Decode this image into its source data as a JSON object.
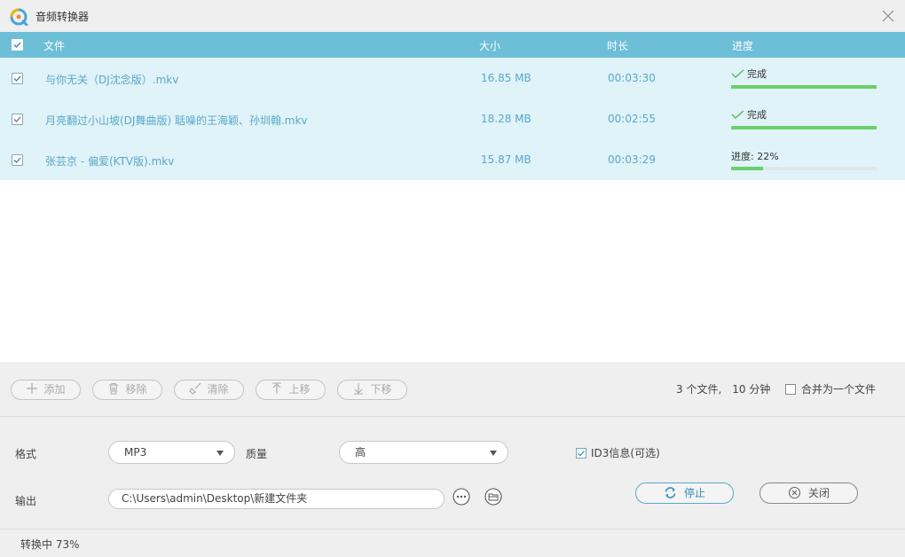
{
  "window": {
    "title": "音频转换器",
    "icons": {
      "logo": "app-logo-icon",
      "close": "close-icon"
    }
  },
  "colors": {
    "header_bg": "#6dbed7",
    "row_bg": "#dff3f8",
    "row_text": "#5aa8c9",
    "progress_fill": "#6ccf6a",
    "stop_accent": "#57a9cf"
  },
  "list": {
    "columns": {
      "file": "文件",
      "size": "大小",
      "duration": "时长",
      "progress": "进度"
    },
    "rows": [
      {
        "checked": true,
        "file": "与你无关（DJ沈念版）.mkv",
        "size": "16.85 MB",
        "duration": "00:03:30",
        "status": "完成",
        "done": true,
        "progress": 1.0
      },
      {
        "checked": true,
        "file": "月亮翻过小山坡(DJ舞曲版) 聒噪的王海颖、孙圳翰.mkv",
        "size": "18.28 MB",
        "duration": "00:02:55",
        "status": "完成",
        "done": true,
        "progress": 1.0
      },
      {
        "checked": true,
        "file": "张芸京 - 偏爱(KTV版).mkv",
        "size": "15.87 MB",
        "duration": "00:03:29",
        "status": "进度: 22%",
        "done": false,
        "progress": 0.22
      }
    ]
  },
  "toolbar": {
    "add": "添加",
    "remove": "移除",
    "clear": "清除",
    "up": "上移",
    "down": "下移",
    "icons": {
      "add": "plus-icon",
      "remove": "trash-icon",
      "clear": "broom-icon",
      "up": "arrow-up-icon",
      "down": "arrow-down-icon"
    },
    "summary": "3 个文件,　10 分钟",
    "merge_label": "合并为一个文件",
    "merge_checked": false
  },
  "settings": {
    "format_label": "格式",
    "format_value": "MP3",
    "quality_label": "质量",
    "quality_value": "高",
    "id3_label": "ID3信息(可选)",
    "id3_checked": true,
    "output_label": "输出",
    "output_path": "C:\\Users\\admin\\Desktop\\新建文件夹",
    "icons": {
      "browse": "more-icon",
      "open_folder": "folder-icon"
    }
  },
  "actions": {
    "stop": "停止",
    "close": "关闭",
    "icons": {
      "stop": "refresh-icon",
      "close": "close-circle-icon"
    }
  },
  "status": {
    "text": "转换中 73%"
  }
}
